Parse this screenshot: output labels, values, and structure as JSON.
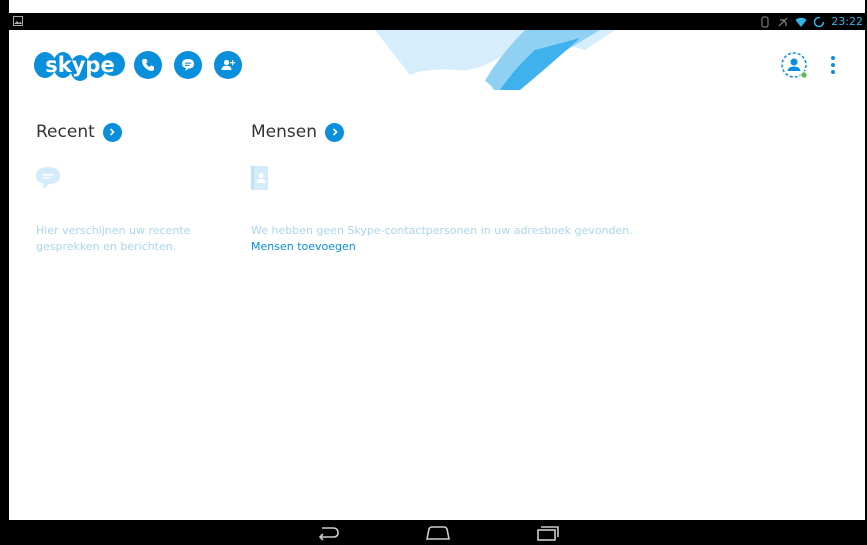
{
  "status_bar": {
    "time": "23:22",
    "icons": [
      "image-notification-icon",
      "bluetooth-icon",
      "silent-icon",
      "wifi-icon",
      "sync-icon"
    ]
  },
  "header": {
    "logo_text": "skype",
    "actions": [
      "call-icon",
      "chat-icon",
      "add-contact-icon"
    ],
    "profile": "profile-avatar-icon",
    "menu": "overflow-menu-icon"
  },
  "recent": {
    "title": "Recent",
    "empty_text": "Hier verschijnen uw recente gesprekken en berichten."
  },
  "people": {
    "title": "Mensen",
    "empty_text": "We hebben geen Skype-contactpersonen in uw adresboek gevonden.",
    "add_link": "Mensen toevoegen"
  },
  "nav_bar": {
    "buttons": [
      "back-icon",
      "home-icon",
      "recent-apps-icon"
    ]
  },
  "colors": {
    "accent": "#0a8fdc",
    "status_blue": "#33b5e5",
    "muted_text": "#a9d6ef",
    "online": "#5cb85c"
  }
}
